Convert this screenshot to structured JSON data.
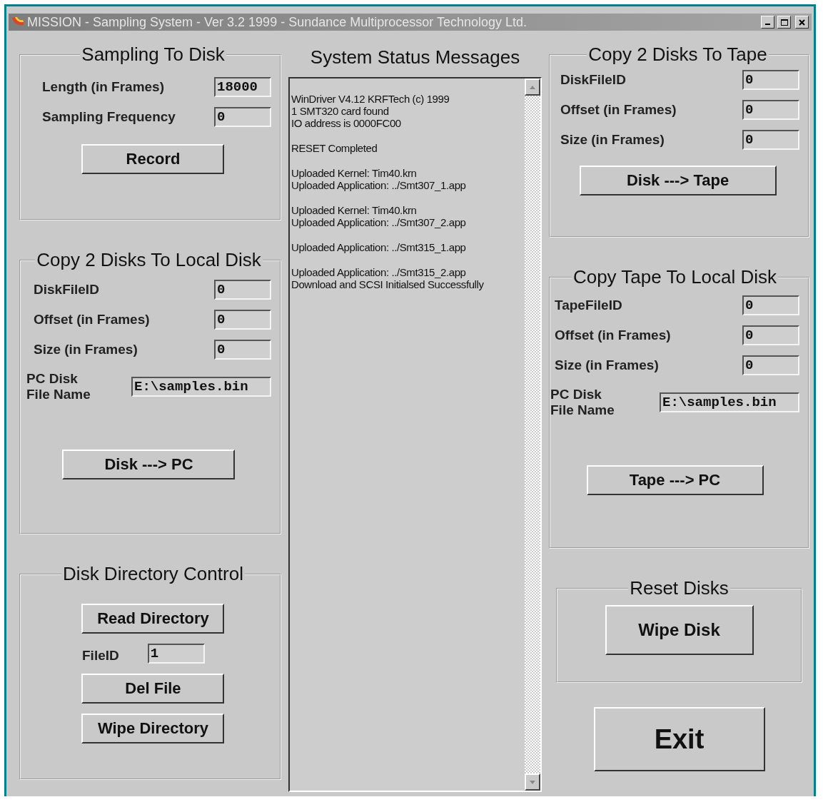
{
  "window": {
    "title": "MISSION - Sampling System -  Ver 3.2  1999 - Sundance Multiprocessor Technology Ltd."
  },
  "left": [
    {
      "title": "Sampling To Disk",
      "items": [
        {
          "kind": "field",
          "label": "Length (in Frames)",
          "value": "18000"
        },
        {
          "kind": "field",
          "label": "Sampling Frequency",
          "value": "0"
        },
        {
          "kind": "button",
          "label": "Record"
        }
      ]
    },
    {
      "title": "Copy 2 Disks To Local Disk",
      "items": [
        {
          "kind": "field",
          "label": "DiskFileID",
          "value": "0"
        },
        {
          "kind": "field",
          "label": "Offset (in Frames)",
          "value": "0"
        },
        {
          "kind": "field",
          "label": "Size (in Frames)",
          "value": "0"
        },
        {
          "kind": "file",
          "label": "PC Disk File Name",
          "value": "E:\\samples.bin"
        },
        {
          "kind": "button",
          "label": "Disk ---> PC"
        }
      ]
    },
    {
      "title": "Disk Directory Control",
      "items": [
        {
          "kind": "button",
          "label": "Read Directory"
        },
        {
          "kind": "small",
          "label": "FileID",
          "value": "1"
        },
        {
          "kind": "button",
          "label": "Del File"
        },
        {
          "kind": "button",
          "label": "Wipe Directory"
        }
      ]
    }
  ],
  "status": {
    "title": "System Status Messages",
    "blocks": [
      [
        "WinDriver V4.12 KRFTech (c) 1999",
        "1 SMT320 card found",
        "IO address is 0000FC00"
      ],
      [
        "RESET Completed"
      ],
      [
        "Uploaded Kernel: Tim40.krn",
        "Uploaded Application: ../Smt307_1.app"
      ],
      [
        "Uploaded Kernel: Tim40.krn",
        "Uploaded Application: ../Smt307_2.app"
      ],
      [
        "Uploaded Application: ../Smt315_1.app"
      ],
      [
        "Uploaded Application: ../Smt315_2.app",
        "Download and SCSI Initialsed Successfully"
      ]
    ]
  },
  "right": [
    {
      "title": "Copy 2 Disks To Tape",
      "items": [
        {
          "kind": "field",
          "label": "DiskFileID",
          "value": "0"
        },
        {
          "kind": "field",
          "label": "Offset (in Frames)",
          "value": "0"
        },
        {
          "kind": "field",
          "label": "Size (in Frames)",
          "value": "0"
        },
        {
          "kind": "button",
          "label": "Disk ---> Tape"
        }
      ]
    },
    {
      "title": "Copy Tape To Local Disk",
      "items": [
        {
          "kind": "field",
          "label": "TapeFileID",
          "value": "0"
        },
        {
          "kind": "field",
          "label": "Offset (in Frames)",
          "value": "0"
        },
        {
          "kind": "field",
          "label": "Size (in Frames)",
          "value": "0"
        },
        {
          "kind": "file",
          "label": "PC Disk File Name",
          "value": "E:\\samples.bin"
        },
        {
          "kind": "button",
          "label": "Tape ---> PC"
        }
      ]
    },
    {
      "title": "Reset Disks",
      "items": [
        {
          "kind": "bigbutton",
          "label": "Wipe Disk"
        }
      ]
    }
  ],
  "exit_button": "Exit"
}
